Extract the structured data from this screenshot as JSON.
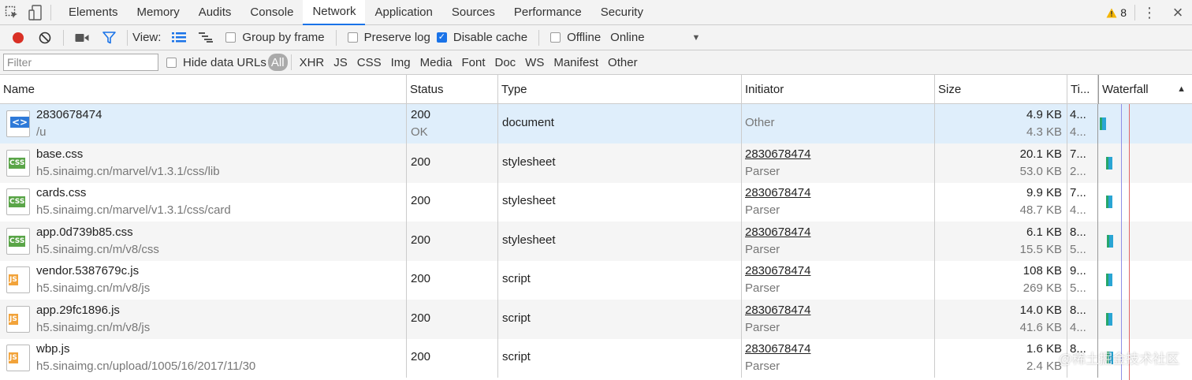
{
  "tabbar": {
    "tabs": [
      "Elements",
      "Memory",
      "Audits",
      "Console",
      "Network",
      "Application",
      "Sources",
      "Performance",
      "Security"
    ],
    "active_tab": "Network",
    "warning_count": "8"
  },
  "toolbar": {
    "view_label": "View:",
    "group_by_frame": "Group by frame",
    "preserve_log": "Preserve log",
    "disable_cache": "Disable cache",
    "offline": "Offline",
    "throttle": "Online",
    "disable_cache_checked": true
  },
  "filterbar": {
    "placeholder": "Filter",
    "hide_data_urls": "Hide data URLs",
    "types": [
      "All",
      "XHR",
      "JS",
      "CSS",
      "Img",
      "Media",
      "Font",
      "Doc",
      "WS",
      "Manifest",
      "Other"
    ],
    "active_type": "All"
  },
  "table": {
    "headers": {
      "name": "Name",
      "status": "Status",
      "type": "Type",
      "initiator": "Initiator",
      "size": "Size",
      "time": "Ti...",
      "waterfall": "Waterfall"
    },
    "rows": [
      {
        "icon": "html-file-icon",
        "badge": "<>",
        "name": "2830678474",
        "path": "/u",
        "status": "200",
        "status_text": "OK",
        "type": "document",
        "initiator": "Other",
        "initiator_sub": "",
        "size": "4.9 KB",
        "size_sub": "4.3 KB",
        "time": "4...",
        "time_sub": "4..."
      },
      {
        "icon": "css-file-icon",
        "badge": "CSS",
        "name": "base.css",
        "path": "h5.sinaimg.cn/marvel/v1.3.1/css/lib",
        "status": "200",
        "status_text": "",
        "type": "stylesheet",
        "initiator": "2830678474",
        "initiator_sub": "Parser",
        "size": "20.1 KB",
        "size_sub": "53.0 KB",
        "time": "7...",
        "time_sub": "2..."
      },
      {
        "icon": "css-file-icon",
        "badge": "CSS",
        "name": "cards.css",
        "path": "h5.sinaimg.cn/marvel/v1.3.1/css/card",
        "status": "200",
        "status_text": "",
        "type": "stylesheet",
        "initiator": "2830678474",
        "initiator_sub": "Parser",
        "size": "9.9 KB",
        "size_sub": "48.7 KB",
        "time": "7...",
        "time_sub": "4..."
      },
      {
        "icon": "css-file-icon",
        "badge": "CSS",
        "name": "app.0d739b85.css",
        "path": "h5.sinaimg.cn/m/v8/css",
        "status": "200",
        "status_text": "",
        "type": "stylesheet",
        "initiator": "2830678474",
        "initiator_sub": "Parser",
        "size": "6.1 KB",
        "size_sub": "15.5 KB",
        "time": "8...",
        "time_sub": "5..."
      },
      {
        "icon": "js-file-icon",
        "badge": "JS",
        "name": "vendor.5387679c.js",
        "path": "h5.sinaimg.cn/m/v8/js",
        "status": "200",
        "status_text": "",
        "type": "script",
        "initiator": "2830678474",
        "initiator_sub": "Parser",
        "size": "108 KB",
        "size_sub": "269 KB",
        "time": "9...",
        "time_sub": "5..."
      },
      {
        "icon": "js-file-icon",
        "badge": "JS",
        "name": "app.29fc1896.js",
        "path": "h5.sinaimg.cn/m/v8/js",
        "status": "200",
        "status_text": "",
        "type": "script",
        "initiator": "2830678474",
        "initiator_sub": "Parser",
        "size": "14.0 KB",
        "size_sub": "41.6 KB",
        "time": "8...",
        "time_sub": "4..."
      },
      {
        "icon": "js-file-icon",
        "badge": "JS",
        "name": "wbp.js",
        "path": "h5.sinaimg.cn/upload/1005/16/2017/11/30",
        "status": "200",
        "status_text": "",
        "type": "script",
        "initiator": "2830678474",
        "initiator_sub": "Parser",
        "size": "1.6 KB",
        "size_sub": "2.4 KB",
        "time": "8...",
        "time_sub": ""
      }
    ]
  },
  "watermark": "@稀土掘金技术社区",
  "colors": {
    "accent": "#1a73e8",
    "record_red": "#d93025",
    "selected_row": "#dfeefb",
    "waterfall_blue": "#2aa5d4",
    "waterfall_green": "#27a66a"
  }
}
